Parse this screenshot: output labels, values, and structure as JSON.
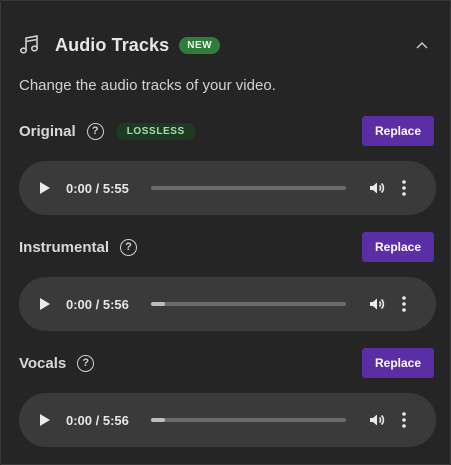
{
  "panel": {
    "title": "Audio Tracks",
    "badge": "NEW",
    "description": "Change the audio tracks of your video.",
    "help_symbol": "?"
  },
  "tracks": [
    {
      "name": "Original",
      "badge": "LOSSLESS",
      "replace_label": "Replace",
      "time": "0:00 / 5:55",
      "progress": 0.0
    },
    {
      "name": "Instrumental",
      "badge": "",
      "replace_label": "Replace",
      "time": "0:00 / 5:56",
      "progress": 0.07
    },
    {
      "name": "Vocals",
      "badge": "",
      "replace_label": "Replace",
      "time": "0:00 / 5:56",
      "progress": 0.07
    }
  ],
  "colors": {
    "accent": "#5b2ea6",
    "new_badge": "#2e7d3a",
    "lossless_badge_bg": "#1f3a22",
    "lossless_badge_text": "#9fe0a8"
  },
  "icons": {
    "header": "music-note-icon",
    "collapse": "chevron-up-icon",
    "play": "play-icon",
    "volume": "volume-icon",
    "more": "more-vertical-icon"
  }
}
